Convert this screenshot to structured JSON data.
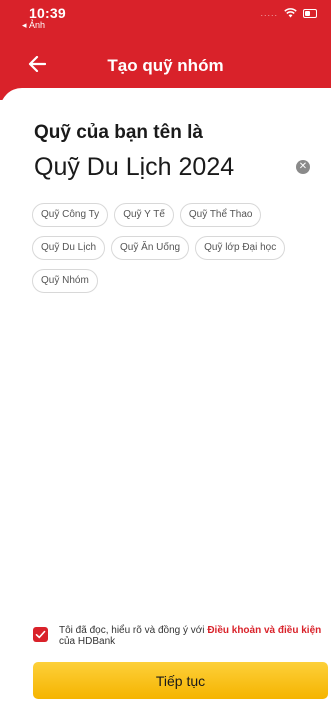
{
  "status_bar": {
    "time": "10:39",
    "back_app": "◂ Ảnh",
    "signal": "....."
  },
  "nav": {
    "title": "Tạo quỹ nhóm",
    "back_icon": "arrow-left-icon"
  },
  "form": {
    "label": "Quỹ của bạn tên là",
    "name_value": "Quỹ Du Lịch 2024",
    "clear_icon": "clear-icon"
  },
  "suggestions": [
    "Quỹ Công Ty",
    "Quỹ Y Tế",
    "Quỹ Thể Thao",
    "Quỹ Du Lịch",
    "Quỹ Ăn Uống",
    "Quỹ lớp Đại học",
    "Quỹ Nhóm"
  ],
  "terms": {
    "checked": true,
    "prefix": "Tôi đã đọc, hiểu rõ và đồng ý với ",
    "link": "Điều khoản và điều kiện",
    "suffix": " của HDBank"
  },
  "continue_label": "Tiếp tục",
  "colors": {
    "brand_red": "#d9222a",
    "button_yellow": "#f5b400"
  }
}
